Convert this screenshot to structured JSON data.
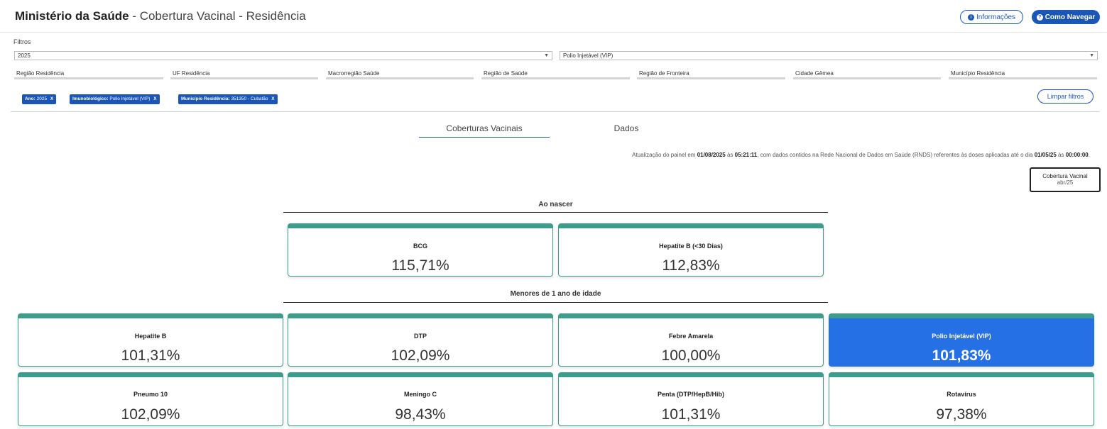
{
  "header": {
    "title_bold": "Ministério da Saúde",
    "title_rest": " - Cobertura Vacinal - Residência",
    "info_button": "Informações",
    "nav_button": "Como Navegar"
  },
  "filters": {
    "label": "Filtros",
    "year": "2025",
    "immunobiological": "Polio Injetável (VIP)",
    "boxes": [
      "Região Residência",
      "UF Residência",
      "Macrorregião Saúde",
      "Região de Saúde",
      "Região de Fronteira",
      "Cidade Gêmea",
      "Município Residência"
    ],
    "chips": [
      {
        "label": "Ano:",
        "value": "2025",
        "x": "X"
      },
      {
        "label": "Imunobiológico:",
        "value": "Polio Injetável (VIP)",
        "x": "X"
      },
      {
        "label": "Município Residência:",
        "value": "351350 - Cubatão",
        "x": "X"
      }
    ],
    "clear_button": "Limpar filtros"
  },
  "tabs": [
    "Coberturas Vacinais",
    "Dados"
  ],
  "update": {
    "p1": "Atualização do painel em ",
    "date1": "01/08/2025",
    "p2": " às ",
    "time1": "05:21:11",
    "p3": ", com dados contidos na Rede Nacional de Dados em Saúde (RNDS) referentes às doses aplicadas até o dia ",
    "date2": "01/05/25",
    "p4": " às ",
    "time2": "00:00:00",
    "p5": "."
  },
  "legend": {
    "title": "Cobertura Vacinal",
    "period": "abr/25"
  },
  "sections": {
    "birth": "Ao nascer",
    "under1": "Menores de 1 ano de idade"
  },
  "cards": {
    "birth": [
      {
        "name": "BCG",
        "value": "115,71%"
      },
      {
        "name": "Hepatite B (<30 Dias)",
        "value": "112,83%"
      }
    ],
    "row1": [
      {
        "name": "Hepatite B",
        "value": "101,31%"
      },
      {
        "name": "DTP",
        "value": "102,09%"
      },
      {
        "name": "Febre Amarela",
        "value": "100,00%"
      },
      {
        "name": "Polio Injetável (VIP)",
        "value": "101,83%"
      }
    ],
    "row2": [
      {
        "name": "Pneumo 10",
        "value": "102,09%"
      },
      {
        "name": "Meningo C",
        "value": "98,43%"
      },
      {
        "name": "Penta (DTP/HepB/Hib)",
        "value": "101,31%"
      },
      {
        "name": "Rotavírus",
        "value": "97,38%"
      }
    ]
  },
  "colors": {
    "primary": "#1a56b8",
    "card_accent": "#3c9d8c",
    "selected": "#2570e4"
  }
}
